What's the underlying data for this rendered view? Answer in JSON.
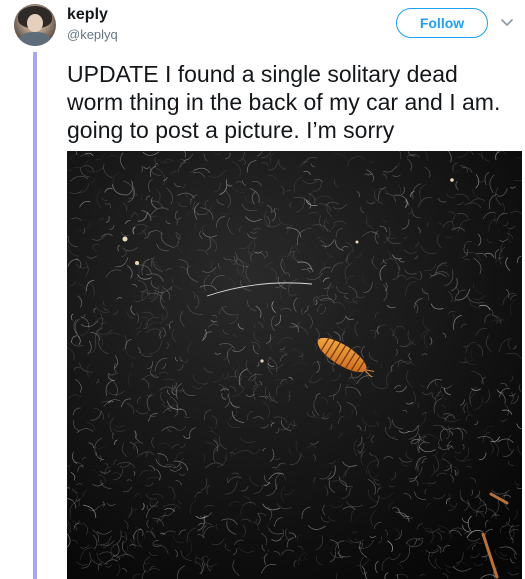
{
  "author": {
    "display_name": "keply",
    "handle": "@keplyq"
  },
  "follow_label": "Follow",
  "tweet_text": "UPDATE I found a single solitary dead worm thing in the back of my car and I am. going to post a picture. I’m sorry",
  "icons": {
    "caret": "chevron-down-icon",
    "avatar": "profile-photo"
  },
  "colors": {
    "accent": "#1da1f2",
    "thread_line": "#a9a6f0",
    "text": "#14171a",
    "secondary_text": "#657786"
  }
}
